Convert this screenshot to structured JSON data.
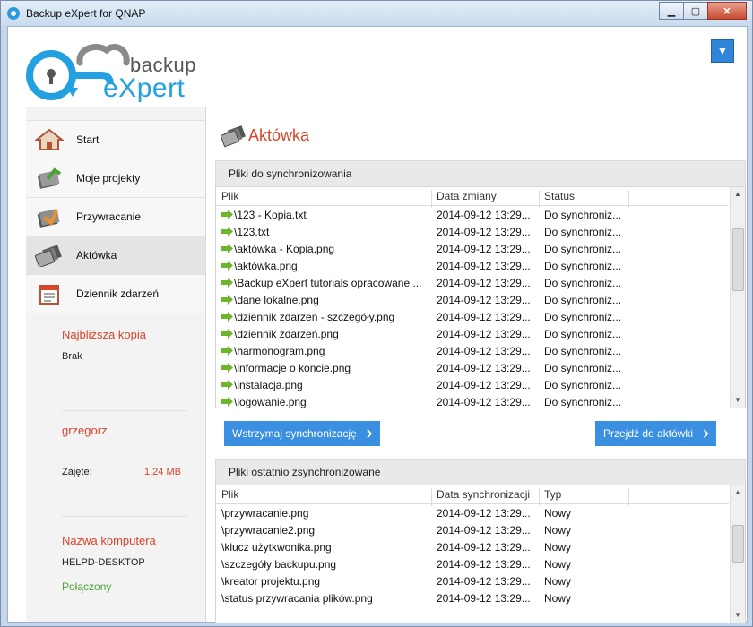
{
  "window": {
    "title": "Backup eXpert for QNAP",
    "minimize": "▁",
    "maximize": "▢",
    "close": "✕"
  },
  "logo": {
    "line1": "backup",
    "line2": "eXpert"
  },
  "menu_toggle": "▼",
  "sidebar": {
    "items": [
      {
        "label": "Start",
        "icon": "home-icon"
      },
      {
        "label": "Moje projekty",
        "icon": "projects-icon"
      },
      {
        "label": "Przywracanie",
        "icon": "restore-icon"
      },
      {
        "label": "Aktówka",
        "icon": "briefcase-icon",
        "active": true
      },
      {
        "label": "Dziennik zdarzeń",
        "icon": "event-log-icon"
      }
    ],
    "next_backup_label": "Najbliższa kopia",
    "next_backup_value": "Brak",
    "username": "grzegorz",
    "used_label": "Zajęte:",
    "used_value": "1,24 MB",
    "computer_label": "Nazwa komputera",
    "computer_value": "HELPD-DESKTOP",
    "connection_status": "Połączony"
  },
  "main": {
    "title": "Aktówka",
    "sync_panel": {
      "header": "Pliki do synchronizowania",
      "columns": [
        "Plik",
        "Data zmiany",
        "Status"
      ],
      "rows": [
        {
          "file": "\\123 - Kopia.txt",
          "date": "2014-09-12 13:29...",
          "status": "Do synchroniz..."
        },
        {
          "file": "\\123.txt",
          "date": "2014-09-12 13:29...",
          "status": "Do synchroniz..."
        },
        {
          "file": "\\aktówka - Kopia.png",
          "date": "2014-09-12 13:29...",
          "status": "Do synchroniz..."
        },
        {
          "file": "\\aktówka.png",
          "date": "2014-09-12 13:29...",
          "status": "Do synchroniz..."
        },
        {
          "file": "\\Backup eXpert tutorials opracowane ...",
          "date": "2014-09-12 13:29...",
          "status": "Do synchroniz..."
        },
        {
          "file": "\\dane lokalne.png",
          "date": "2014-09-12 13:29...",
          "status": "Do synchroniz..."
        },
        {
          "file": "\\dziennik zdarzeń - szczegóły.png",
          "date": "2014-09-12 13:29...",
          "status": "Do synchroniz..."
        },
        {
          "file": "\\dziennik zdarzeń.png",
          "date": "2014-09-12 13:29...",
          "status": "Do synchroniz..."
        },
        {
          "file": "\\harmonogram.png",
          "date": "2014-09-12 13:29...",
          "status": "Do synchroniz..."
        },
        {
          "file": "\\informacje o koncie.png",
          "date": "2014-09-12 13:29...",
          "status": "Do synchroniz..."
        },
        {
          "file": "\\instalacja.png",
          "date": "2014-09-12 13:29...",
          "status": "Do synchroniz..."
        },
        {
          "file": "\\logowanie.png",
          "date": "2014-09-12 13:29...",
          "status": "Do synchroniz..."
        }
      ],
      "pause_button": "Wstrzymaj synchronizację",
      "goto_button": "Przejdź do aktówki"
    },
    "recent_panel": {
      "header": "Pliki ostatnio zsynchronizowane",
      "columns": [
        "Plik",
        "Data synchronizacji",
        "Typ"
      ],
      "rows": [
        {
          "file": "\\przywracanie.png",
          "date": "2014-09-12 13:29...",
          "type": "Nowy"
        },
        {
          "file": "\\przywracanie2.png",
          "date": "2014-09-12 13:29...",
          "type": "Nowy"
        },
        {
          "file": "\\klucz użytkwonika.png",
          "date": "2014-09-12 13:29...",
          "type": "Nowy"
        },
        {
          "file": "\\szczegóły backupu.png",
          "date": "2014-09-12 13:29...",
          "type": "Nowy"
        },
        {
          "file": "\\kreator projektu.png",
          "date": "2014-09-12 13:29...",
          "type": "Nowy"
        },
        {
          "file": "\\status przywracania plików.png",
          "date": "2014-09-12 13:29...",
          "type": "Nowy"
        }
      ]
    }
  },
  "colors": {
    "accent": "#3b8fe0",
    "title_red": "#d9442a",
    "ok_green": "#4ca23a",
    "logo_blue": "#22a0e0"
  }
}
